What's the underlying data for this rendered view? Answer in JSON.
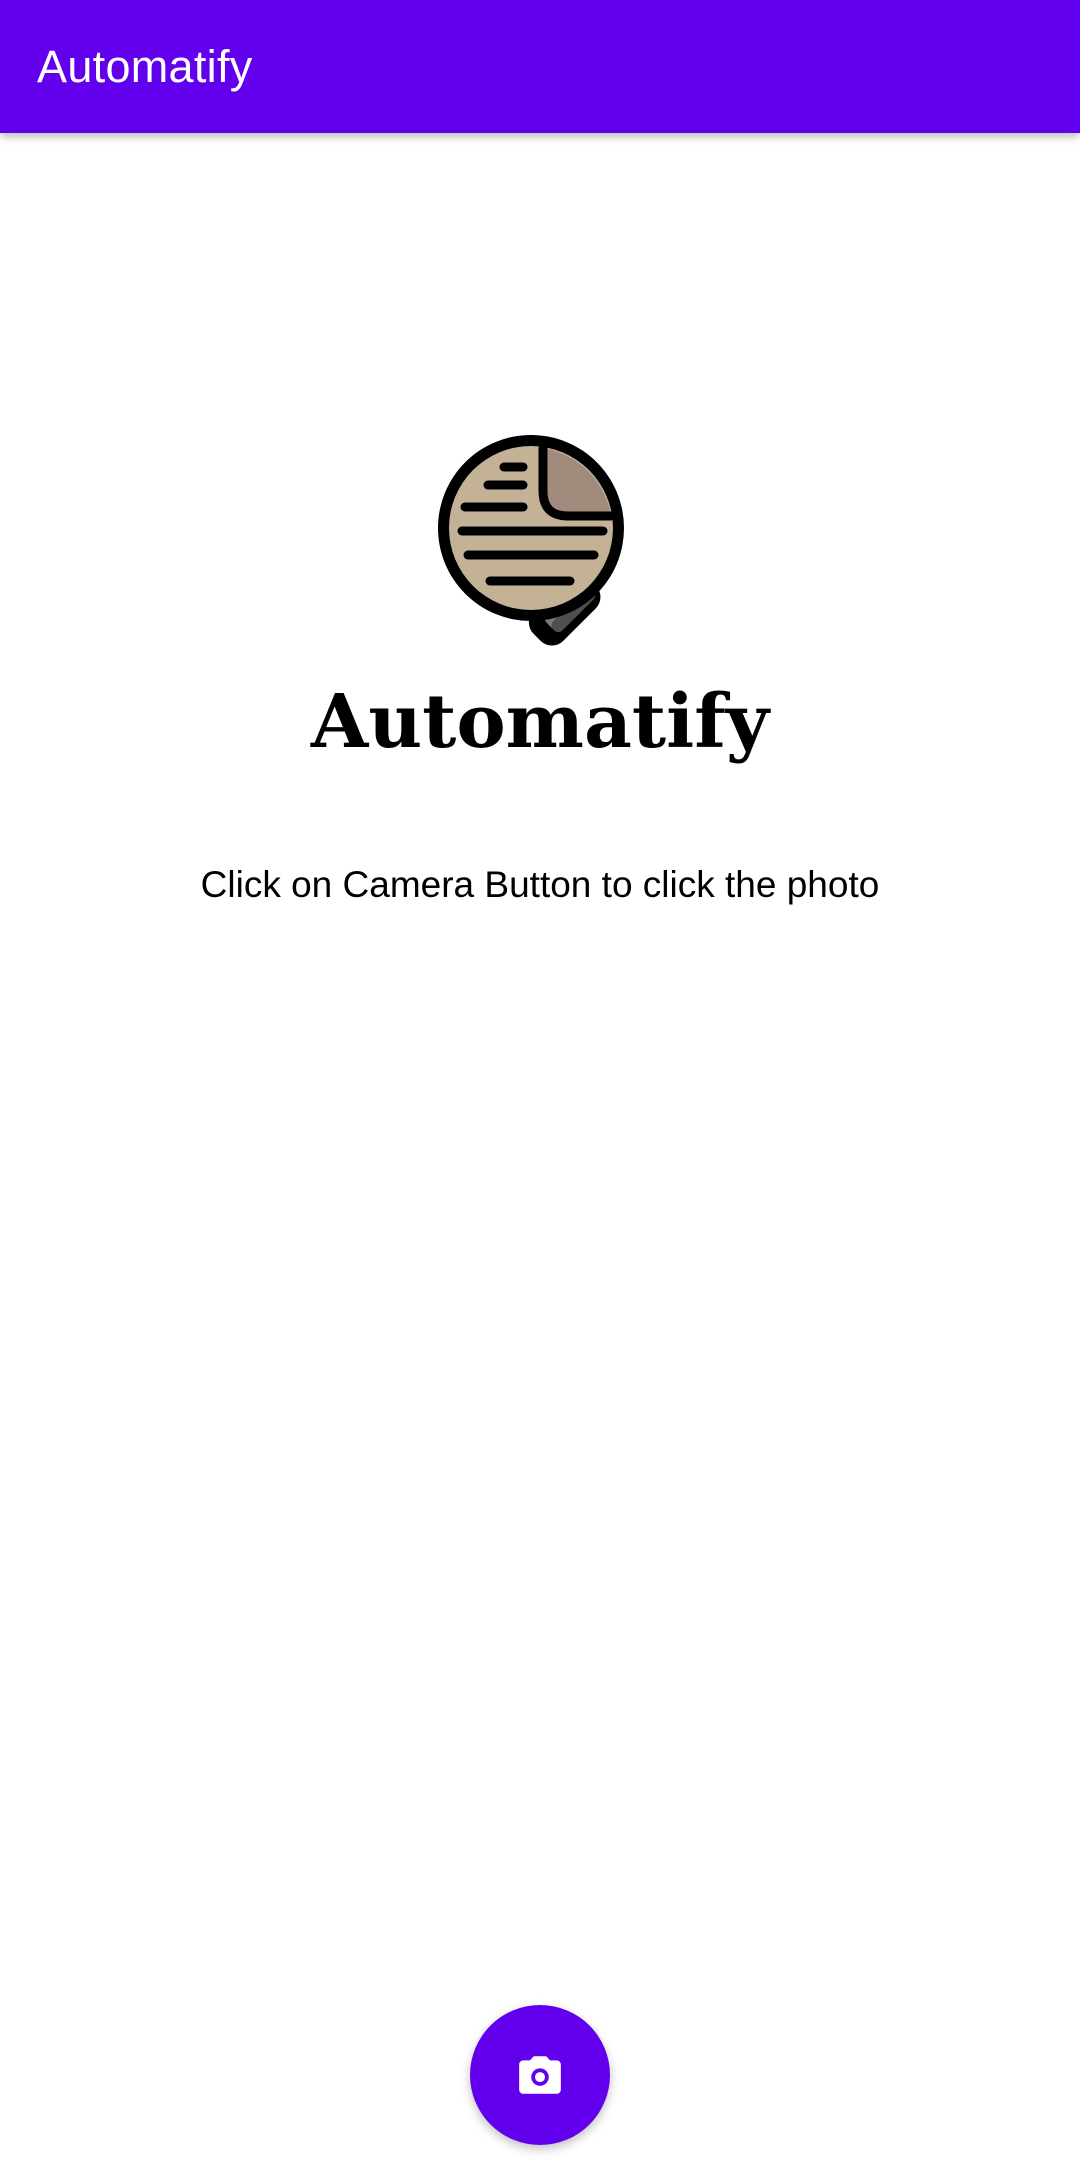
{
  "app_bar": {
    "title": "Automatify",
    "color": "#6200EE"
  },
  "main": {
    "logo_icon": "document-magnifier-icon",
    "brand_title": "Automatify",
    "instruction": "Click on Camera Button to click the photo"
  },
  "fab": {
    "icon": "camera-icon",
    "color": "#6200EE"
  }
}
